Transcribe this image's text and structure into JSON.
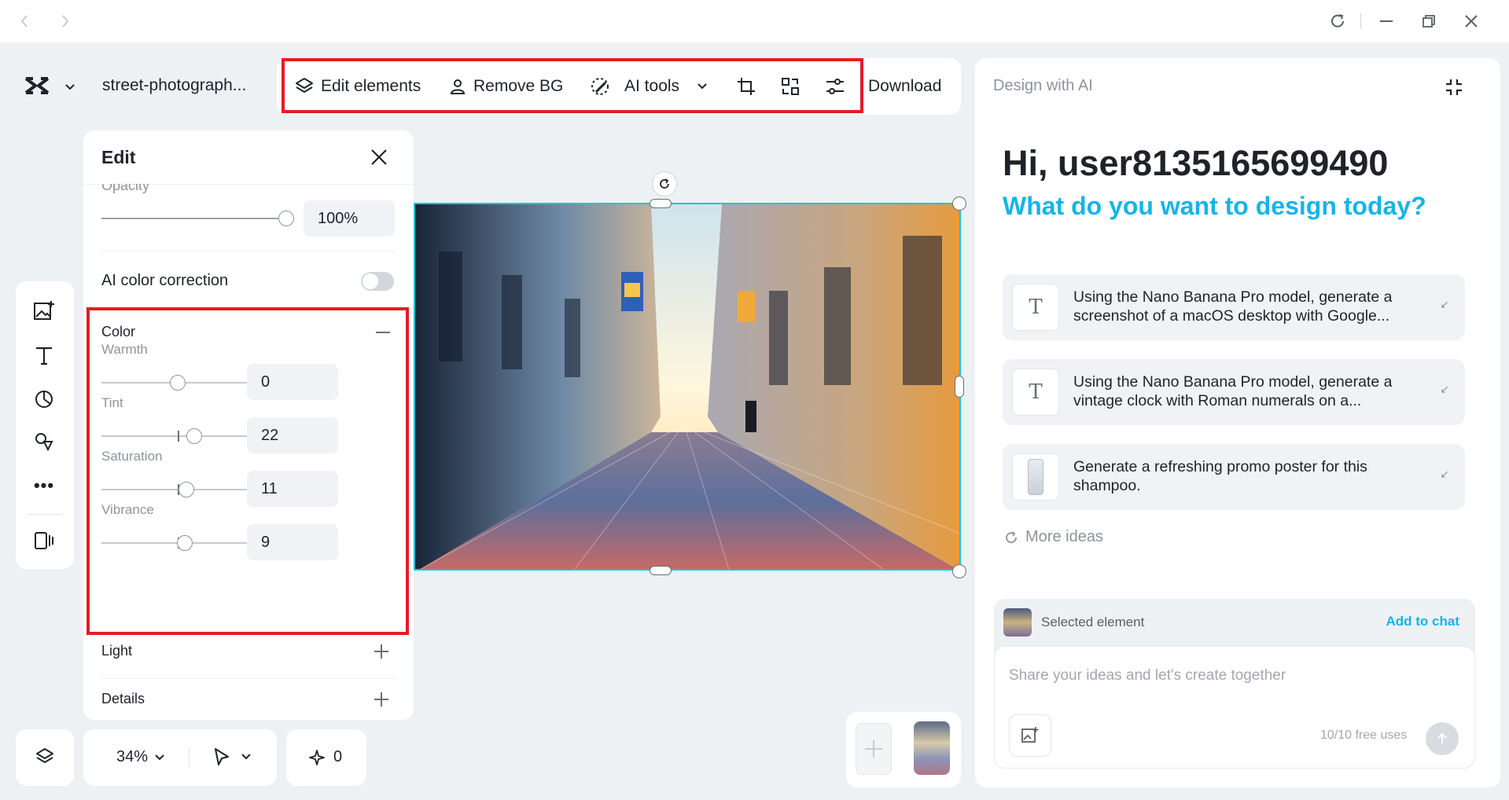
{
  "window": {
    "title": ""
  },
  "header": {
    "file_name": "street-photograph...",
    "tools": {
      "edit_elements": "Edit elements",
      "remove_bg": "Remove BG",
      "ai_tools": "AI tools",
      "download": "Download"
    }
  },
  "edit_panel": {
    "title": "Edit",
    "opacity_label": "Opacity",
    "opacity_value": "100%",
    "opacity_level": 1.0,
    "ai_color_correction": "AI color correction",
    "ai_color_correction_on": false,
    "color": {
      "title": "Color",
      "sliders": [
        {
          "label": "Warmth",
          "value": "0",
          "level": 0.5
        },
        {
          "label": "Tint",
          "value": "22",
          "level": 0.61
        },
        {
          "label": "Saturation",
          "value": "11",
          "level": 0.555
        },
        {
          "label": "Vibrance",
          "value": "9",
          "level": 0.545
        }
      ]
    },
    "light": "Light",
    "details": "Details"
  },
  "bottom_bar": {
    "zoom": "34%",
    "ai_credits": "0"
  },
  "ai_panel": {
    "header": "Design with AI",
    "greeting": "Hi, user8135165699490",
    "prompt": "What do you want to design today?",
    "suggestions": [
      {
        "icon": "text-icon",
        "text": "Using the Nano Banana Pro model, generate a screenshot of a macOS desktop with Google..."
      },
      {
        "icon": "text-icon",
        "text": "Using the Nano Banana Pro model, generate a vintage clock with Roman numerals on a..."
      },
      {
        "icon": "image-thumbnail",
        "text": "Generate a refreshing promo poster for this shampoo."
      }
    ],
    "more_ideas": "More ideas",
    "selected_element": "Selected element",
    "add_to_chat": "Add to chat",
    "input_placeholder": "Share your ideas and let's create together",
    "free_uses": "10/10 free uses"
  },
  "colors": {
    "accent": "#16b4e6",
    "highlight_box": "#e51c23",
    "selection": "#17c5d9"
  }
}
